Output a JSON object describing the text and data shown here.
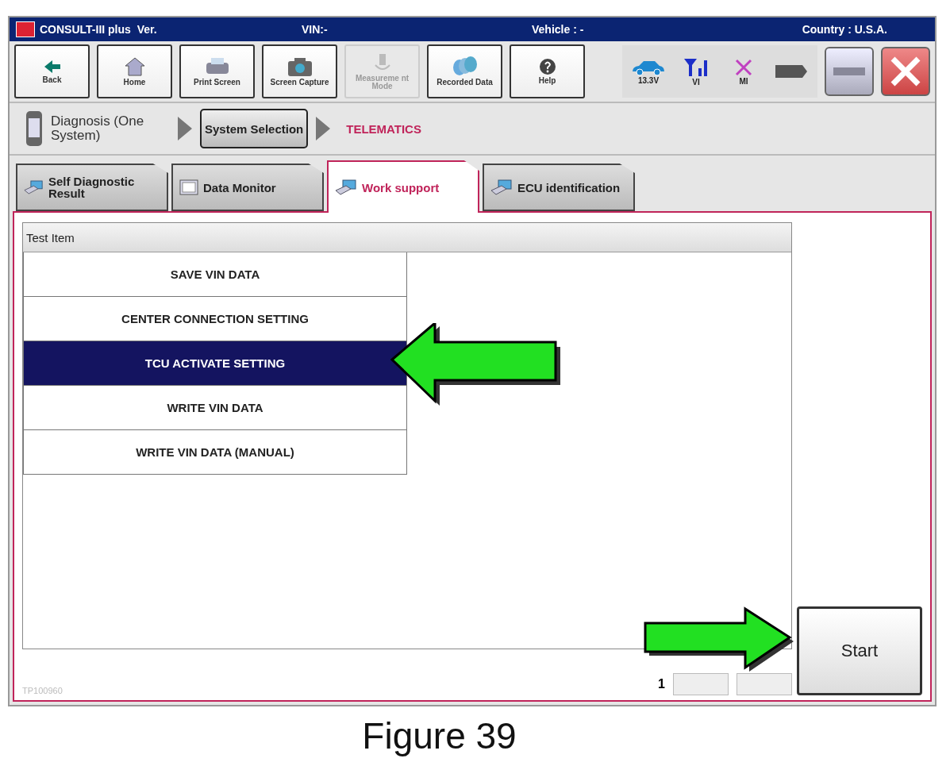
{
  "window": {
    "app": "CONSULT-III plus  Ver.",
    "vin": "VIN:-",
    "vehicle": "Vehicle : -",
    "country": "Country : U.S.A."
  },
  "toolbar": [
    {
      "kind": "back",
      "label": "Back",
      "disabled": false
    },
    {
      "kind": "home",
      "label": "Home",
      "disabled": false
    },
    {
      "kind": "print",
      "label": "Print Screen",
      "disabled": false
    },
    {
      "kind": "camera",
      "label": "Screen Capture",
      "disabled": false
    },
    {
      "kind": "meter",
      "label": "Measureme nt Mode",
      "disabled": true
    },
    {
      "kind": "disks",
      "label": "Recorded Data",
      "disabled": false
    },
    {
      "kind": "help",
      "label": "Help",
      "disabled": false
    }
  ],
  "status": [
    {
      "kind": "car",
      "label": "13.3V"
    },
    {
      "kind": "signal",
      "label": "VI"
    },
    {
      "kind": "cross",
      "label": "MI"
    },
    {
      "kind": "plug"
    }
  ],
  "breadcrumb": {
    "first": "Diagnosis (One System)",
    "button": "System Selection",
    "current": "TELEMATICS"
  },
  "tabs": [
    {
      "label": "Self Diagnostic Result",
      "selected": false
    },
    {
      "label": "Data Monitor",
      "selected": false
    },
    {
      "label": "Work support",
      "selected": true
    },
    {
      "label": "ECU identification",
      "selected": false
    }
  ],
  "list": {
    "header": "Test Item",
    "items": [
      {
        "label": "SAVE VIN DATA",
        "selected": false
      },
      {
        "label": "CENTER CONNECTION SETTING",
        "selected": false
      },
      {
        "label": "TCU ACTIVATE SETTING",
        "selected": true
      },
      {
        "label": "WRITE VIN DATA",
        "selected": false
      },
      {
        "label": "WRITE VIN DATA (MANUAL)",
        "selected": false
      }
    ]
  },
  "page": "1",
  "start": "Start",
  "code": "TP100960",
  "arrows": [
    {
      "kind": "left"
    },
    {
      "kind": "right"
    }
  ],
  "caption": "Figure 39"
}
